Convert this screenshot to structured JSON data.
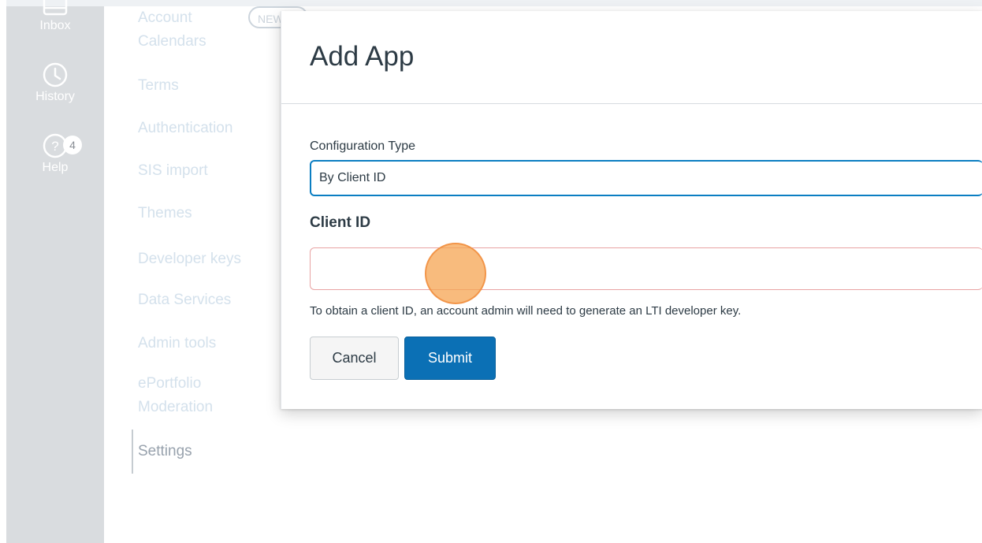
{
  "global_nav": {
    "items": [
      {
        "label": "Inbox",
        "icon": "inbox-icon"
      },
      {
        "label": "History",
        "icon": "clock-icon"
      },
      {
        "label": "Help",
        "icon": "help-icon",
        "badge": "4"
      }
    ]
  },
  "account_nav": {
    "new_badge": "NEW",
    "items": [
      {
        "label": "Account Calendars"
      },
      {
        "label": "Terms"
      },
      {
        "label": "Authentication"
      },
      {
        "label": "SIS import"
      },
      {
        "label": "Themes"
      },
      {
        "label": "Developer keys"
      },
      {
        "label": "Data Services"
      },
      {
        "label": "Admin tools"
      },
      {
        "label": "ePortfolio Moderation"
      },
      {
        "label": "Settings",
        "active": true
      }
    ]
  },
  "modal": {
    "title": "Add App",
    "configuration_type_label": "Configuration Type",
    "configuration_type_value": "By Client ID",
    "client_id_label": "Client ID",
    "client_id_value": "",
    "help_text": "To obtain a client ID, an account admin will need to generate an LTI developer key.",
    "cancel_label": "Cancel",
    "submit_label": "Submit"
  },
  "colors": {
    "primary": "#0b70b5",
    "focus_border": "#0b7ec2",
    "error_border": "#e8a3a3",
    "nav_bg": "#d9dcdf",
    "cursor_highlight": "#f6a452"
  }
}
